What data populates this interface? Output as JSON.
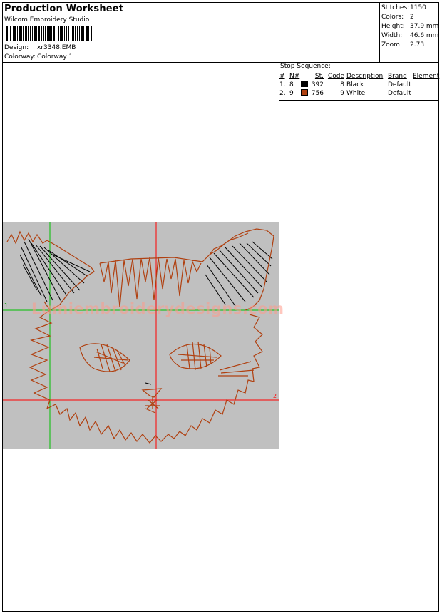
{
  "header": {
    "title": "Production Worksheet",
    "software": "Wilcom Embroidery Studio",
    "design_label": "Design:",
    "design_value": "xr3348.EMB",
    "colorway_label": "Colorway:",
    "colorway_value": "Colorway 1"
  },
  "stats": [
    {
      "label": "Stitches:",
      "value": "1150"
    },
    {
      "label": "Colors:",
      "value": "2"
    },
    {
      "label": "Height:",
      "value": "37.9 mm"
    },
    {
      "label": "Width:",
      "value": "46.6 mm"
    },
    {
      "label": "Zoom:",
      "value": "2.73"
    }
  ],
  "stop_sequence": {
    "title": "Stop Sequence:",
    "columns": [
      "#",
      "N#",
      "St.",
      "Code",
      "Description",
      "Brand",
      "Element"
    ],
    "rows": [
      {
        "num": "1.",
        "n": "8",
        "color": "#000000",
        "stitches": "392",
        "code": "8",
        "description": "Black",
        "brand": "Default",
        "element": ""
      },
      {
        "num": "2.",
        "n": "9",
        "color": "#b04010",
        "stitches": "756",
        "code": "9",
        "description": "White",
        "brand": "Default",
        "element": ""
      }
    ]
  },
  "design": {
    "watermark": "Lumiembroiderydesigns.com",
    "marker_1": "1",
    "marker_2": "2",
    "thread_dark": "#000000",
    "thread_brown": "#b04010",
    "background": "#c0c0c0",
    "crosshair_red": "#ff0000",
    "crosshair_green": "#00c000"
  }
}
